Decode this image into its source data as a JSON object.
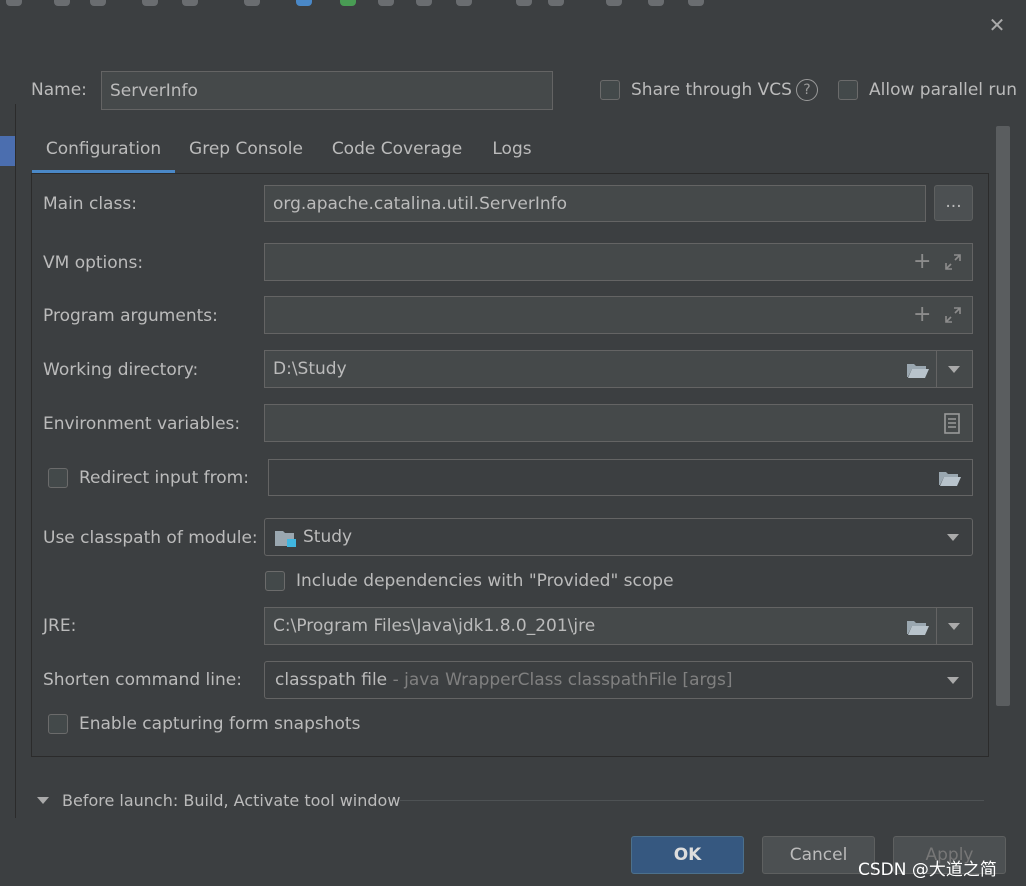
{
  "name": {
    "label": "Name:",
    "value": "ServerInfo"
  },
  "share_vcs": {
    "label": "Share through VCS",
    "checked": false
  },
  "help_icon": "question-circle",
  "allow_parallel": {
    "label": "Allow parallel run",
    "checked": false
  },
  "tabs": [
    {
      "label": "Configuration",
      "active": true
    },
    {
      "label": "Grep Console",
      "active": false
    },
    {
      "label": "Code Coverage",
      "active": false
    },
    {
      "label": "Logs",
      "active": false
    }
  ],
  "config": {
    "main_class": {
      "label": "Main class:",
      "value": "org.apache.catalina.util.ServerInfo",
      "browse_label": "..."
    },
    "vm_options": {
      "label": "VM options:",
      "value": ""
    },
    "program_arguments": {
      "label": "Program arguments:",
      "value": ""
    },
    "working_directory": {
      "label": "Working directory:",
      "value": "D:\\Study"
    },
    "environment_variables": {
      "label": "Environment variables:",
      "value": ""
    },
    "redirect_input": {
      "label": "Redirect input from:",
      "checked": false,
      "value": ""
    },
    "classpath_module": {
      "label": "Use classpath of module:",
      "value": "Study"
    },
    "include_dependencies": {
      "label": "Include dependencies with \"Provided\" scope",
      "checked": false
    },
    "jre": {
      "label": "JRE:",
      "value": "C:\\Program Files\\Java\\jdk1.8.0_201\\jre"
    },
    "shorten_command_line": {
      "label": "Shorten command line:",
      "value": "classpath file",
      "hint": "- java WrapperClass classpathFile [args]"
    },
    "capture_snapshots": {
      "label": "Enable capturing form snapshots",
      "checked": false
    }
  },
  "before_launch": {
    "label": "Before launch: Build, Activate tool window"
  },
  "buttons": {
    "ok": "OK",
    "cancel": "Cancel",
    "apply": "Apply"
  },
  "watermark": "CSDN @大道之简",
  "colors": {
    "background": "#3c3f41",
    "field": "#45494a",
    "accent": "#4a88c7",
    "ok_button": "#365880"
  }
}
